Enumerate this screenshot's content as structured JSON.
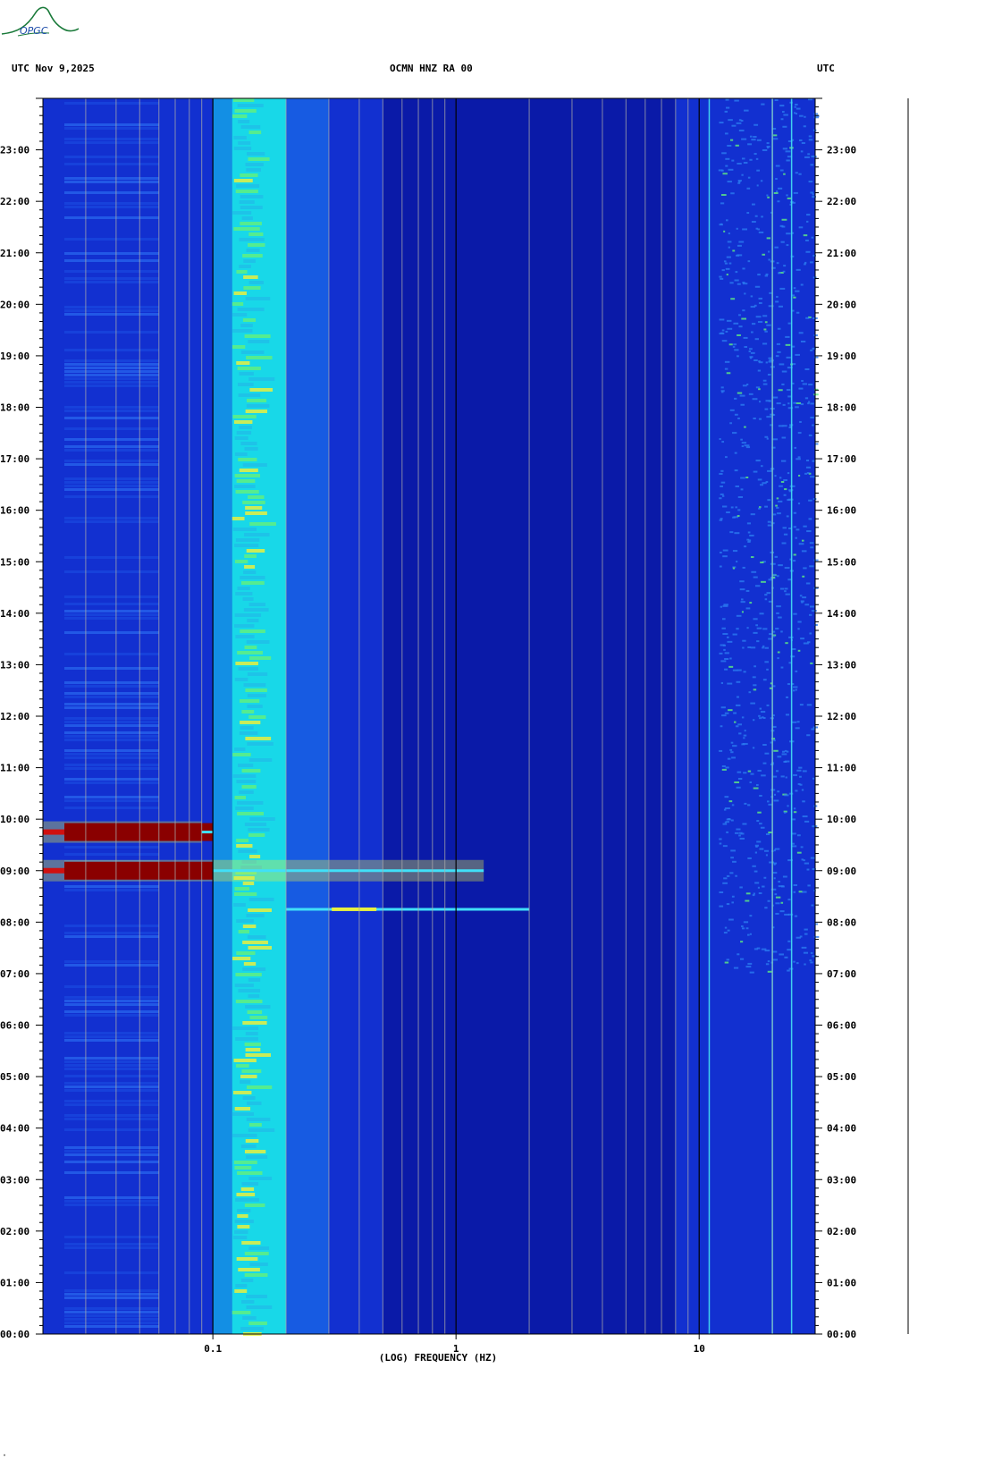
{
  "header": {
    "left": "UTC  Nov 9,2025",
    "center": "OCMN HNZ RA 00",
    "right": "UTC"
  },
  "logo": {
    "text": "OPGC"
  },
  "footer_mark": "\"",
  "colors": {
    "background_blue": "#1230d0",
    "deep_blue": "#0a1aa8",
    "cyan": "#18d8e8",
    "green": "#60f080",
    "yellow": "#e8f040",
    "dark_red": "#8a0000",
    "red": "#d01010"
  },
  "chart_data": {
    "type": "heatmap",
    "title": "OCMN HNZ RA 00",
    "xlabel": "(LOG) FREQUENCY (HZ)",
    "ylabel": "UTC",
    "x_scale": "log",
    "xlim": [
      0.02,
      30
    ],
    "ylim": [
      "00:00",
      "24:00"
    ],
    "x_ticks": [
      {
        "value": 0.1,
        "label": "0.1"
      },
      {
        "value": 1,
        "label": "1"
      },
      {
        "value": 10,
        "label": "10"
      }
    ],
    "y_ticks": [
      "00:00",
      "01:00",
      "02:00",
      "03:00",
      "04:00",
      "05:00",
      "06:00",
      "07:00",
      "08:00",
      "09:00",
      "10:00",
      "11:00",
      "12:00",
      "13:00",
      "14:00",
      "15:00",
      "16:00",
      "17:00",
      "18:00",
      "19:00",
      "20:00",
      "21:00",
      "22:00",
      "23:00"
    ],
    "microseism_band_hz": [
      0.12,
      0.2
    ],
    "events": [
      {
        "utc": "08:15",
        "freq_hz": [
          0.2,
          2.0
        ],
        "peak_hz": 0.35,
        "intensity": "moderate"
      },
      {
        "utc": "09:00",
        "freq_hz": [
          0.02,
          1.3
        ],
        "peak_hz": 0.05,
        "intensity": "high"
      },
      {
        "utc": "09:45",
        "freq_hz": [
          0.02,
          0.09
        ],
        "peak_hz": 0.05,
        "intensity": "high"
      }
    ],
    "high_freq_noise_hz": [
      12,
      30
    ],
    "high_freq_noise_utc": [
      "07:00",
      "24:00"
    ],
    "persistent_lines_hz": [
      11,
      20,
      24
    ]
  }
}
